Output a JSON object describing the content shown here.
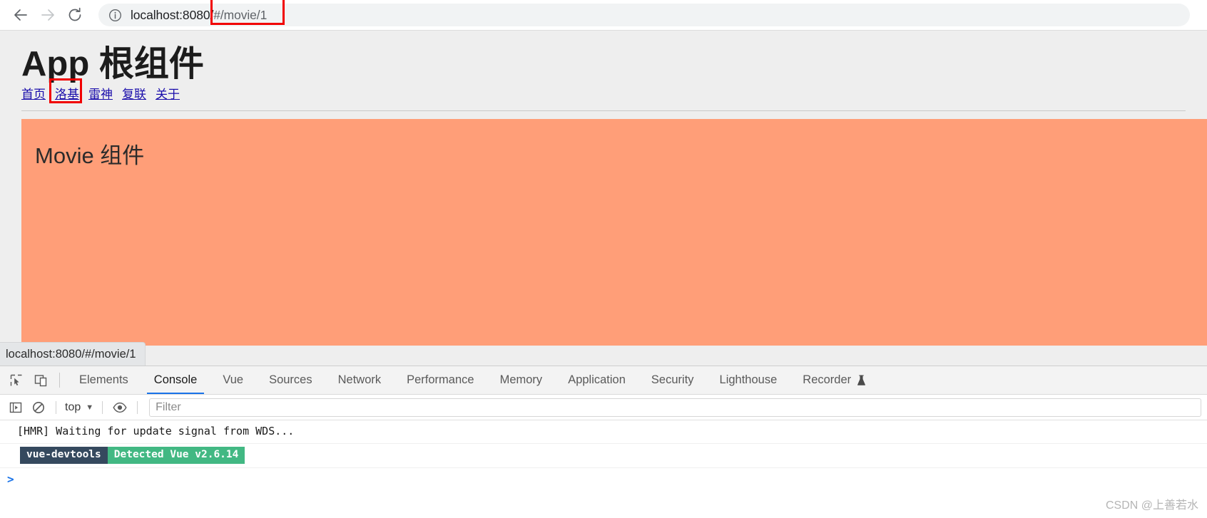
{
  "browser": {
    "back_label": "back-arrow",
    "forward_label": "forward-arrow",
    "reload_label": "reload",
    "url_host": "localhost:8080/",
    "url_hash": "#/movie/1",
    "url_full": "localhost:8080/#/movie/1"
  },
  "page": {
    "title": "App 根组件",
    "nav": [
      {
        "label": "首页",
        "highlighted": false
      },
      {
        "label": "洛基",
        "highlighted": true
      },
      {
        "label": "雷神",
        "highlighted": false
      },
      {
        "label": "复联",
        "highlighted": false
      },
      {
        "label": "关于",
        "highlighted": false
      }
    ],
    "movie_panel_title": "Movie 组件",
    "movie_panel_color": "#FF9E78",
    "link_color": "#1a0dab",
    "highlight_color": "#f10000",
    "background_color": "#eeeeee"
  },
  "status_bar": {
    "text": "localhost:8080/#/movie/1"
  },
  "devtools": {
    "tabs": [
      {
        "label": "Elements",
        "active": false
      },
      {
        "label": "Console",
        "active": true
      },
      {
        "label": "Vue",
        "active": false
      },
      {
        "label": "Sources",
        "active": false
      },
      {
        "label": "Network",
        "active": false
      },
      {
        "label": "Performance",
        "active": false
      },
      {
        "label": "Memory",
        "active": false
      },
      {
        "label": "Application",
        "active": false
      },
      {
        "label": "Security",
        "active": false
      },
      {
        "label": "Lighthouse",
        "active": false
      },
      {
        "label": "Recorder",
        "active": false,
        "experimental": true
      }
    ],
    "active_tab_accent": "#1a73e8",
    "toolbar": {
      "context_label": "top",
      "context_caret": "▼",
      "filter_placeholder": "Filter"
    },
    "console": {
      "messages": [
        {
          "type": "text",
          "text": "[HMR] Waiting for update signal from WDS..."
        }
      ],
      "badge": {
        "left_label": "vue-devtools",
        "right_label": "Detected Vue v2.6.14",
        "left_color": "#35495e",
        "right_color": "#42b883"
      },
      "prompt": ">"
    }
  },
  "watermark": {
    "text": "CSDN @上善若水"
  }
}
